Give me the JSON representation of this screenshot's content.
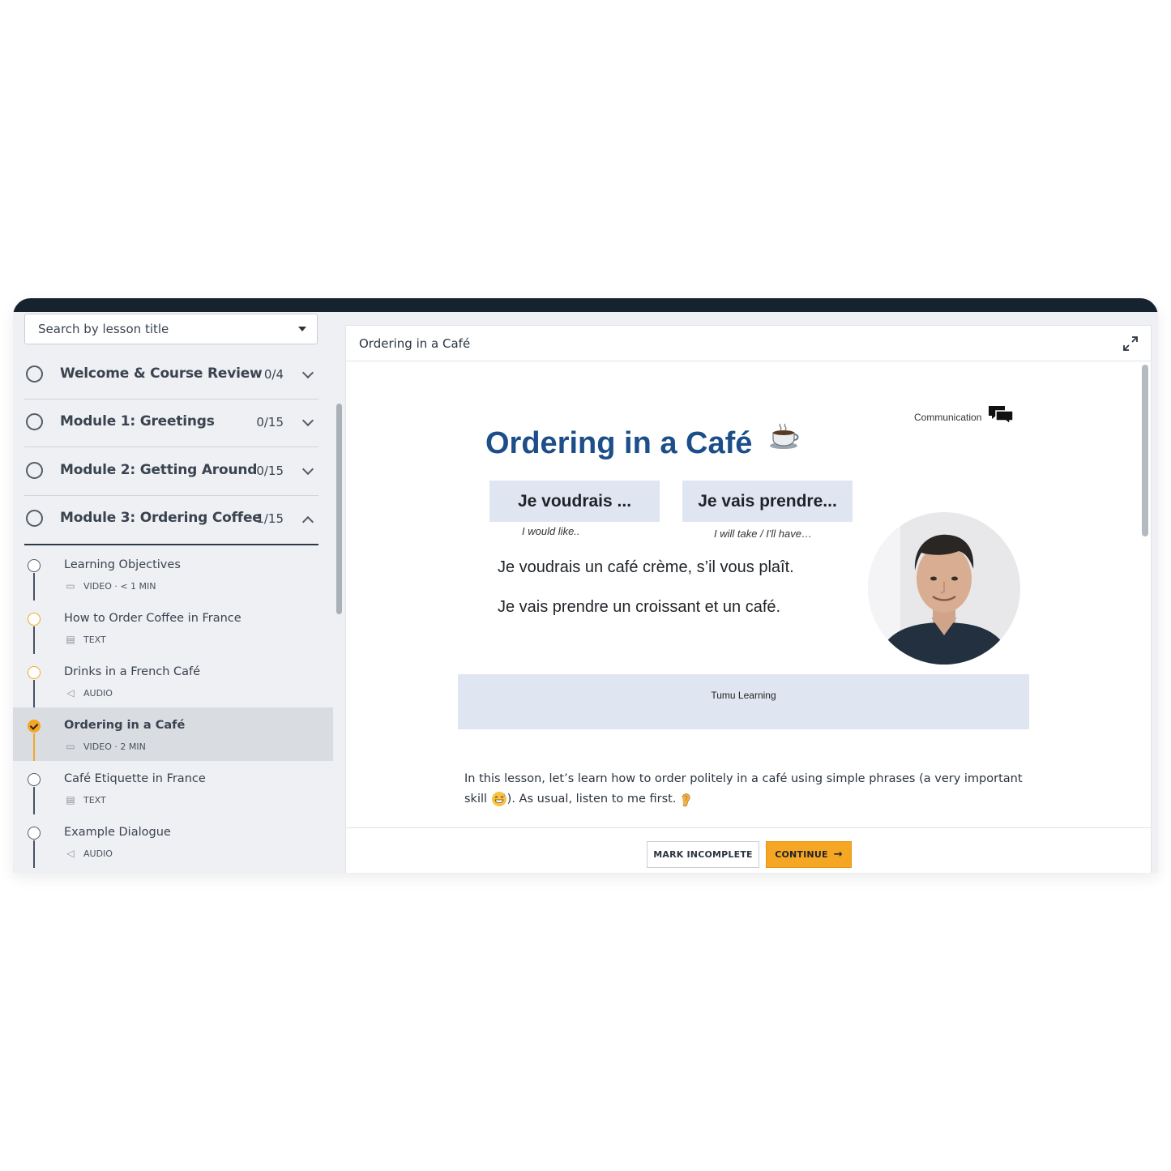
{
  "colors": {
    "accent": "#f5a623",
    "topbar": "#17222f",
    "title_blue": "#1c4f8a",
    "slide_band": "#dfe6f1"
  },
  "sidebar": {
    "search": {
      "placeholder": "Search by lesson title"
    },
    "modules": [
      {
        "title": "Welcome & Course Review",
        "count": "0/4",
        "expanded": false
      },
      {
        "title": "Module 1: Greetings",
        "count": "0/15",
        "expanded": false
      },
      {
        "title": "Module 2: Getting Around",
        "count": "0/15",
        "expanded": false
      },
      {
        "title": "Module 3: Ordering Coffee",
        "count": "1/15",
        "expanded": true
      }
    ],
    "lessons": [
      {
        "title": "Learning Objectives",
        "type_icon": "video-icon",
        "meta": "VIDEO · < 1 MIN",
        "status": "not-started"
      },
      {
        "title": "How to Order Coffee in France",
        "type_icon": "text-icon",
        "meta": "TEXT",
        "status": "in-progress"
      },
      {
        "title": "Drinks in a French Café",
        "type_icon": "audio-icon",
        "meta": "AUDIO",
        "status": "in-progress"
      },
      {
        "title": "Ordering in a Café",
        "type_icon": "video-icon",
        "meta": "VIDEO · 2 MIN",
        "status": "complete",
        "active": true
      },
      {
        "title": "Café Etiquette in France",
        "type_icon": "text-icon",
        "meta": "TEXT",
        "status": "not-started"
      },
      {
        "title": "Example Dialogue",
        "type_icon": "audio-icon",
        "meta": "AUDIO",
        "status": "not-started"
      }
    ]
  },
  "main": {
    "title": "Ordering in a Café",
    "slide": {
      "category": "Communication",
      "title": "Ordering in a Café",
      "phrases": [
        {
          "text": "Je voudrais ...",
          "gloss": "I would like.."
        },
        {
          "text": "Je vais prendre...",
          "gloss": "I will take / I'll have…"
        }
      ],
      "sentences": [
        "Je voudrais un café crème, s’il vous plaît.",
        "Je vais prendre un croissant et un café."
      ],
      "brand": "Tumu Learning"
    },
    "intro_text_1": "In this lesson, let’s learn how to order politely in a café using simple phrases (a very important skill ",
    "intro_text_2": "). As usual, listen to me first. ",
    "buttons": {
      "mark_incomplete": "MARK INCOMPLETE",
      "continue": "CONTINUE"
    }
  }
}
